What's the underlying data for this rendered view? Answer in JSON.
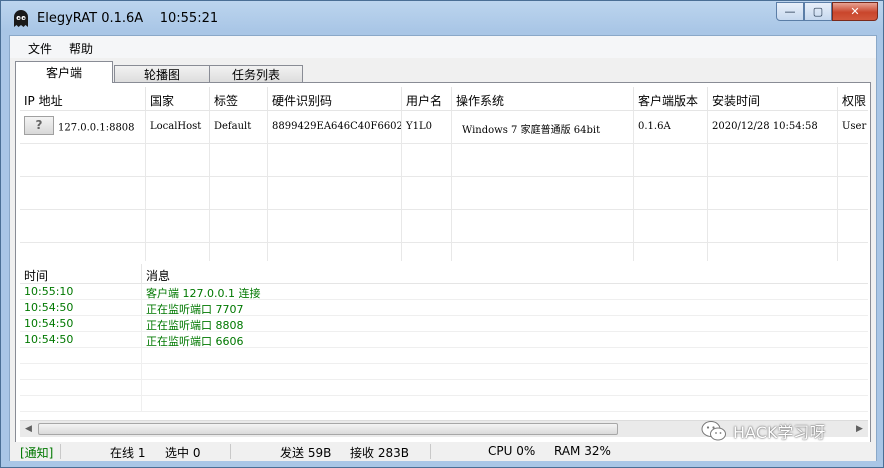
{
  "window": {
    "title": "ElegyRAT 0.1.6A",
    "time": "10:55:21",
    "controls": {
      "minimize": "—",
      "maximize": "▢",
      "close": "✕"
    }
  },
  "menu": [
    "文件",
    "帮助"
  ],
  "tabs": [
    "客户端",
    "轮播图",
    "任务列表"
  ],
  "clients": {
    "columns": [
      "IP 地址",
      "国家",
      "标签",
      "硬件识别码",
      "用户名",
      "操作系统",
      "客户端版本",
      "安装时间",
      "权限"
    ],
    "rows": [
      {
        "flag": "?",
        "ip": "127.0.0.1:8808",
        "country": "LocalHost",
        "tag": "Default",
        "hwid": "8899429EA646C40F6602",
        "user": "Y1L0",
        "os": "Windows 7 家庭普通版  64bit",
        "version": "0.1.6A",
        "install_time": "2020/12/28 10:54:58",
        "permission": "User"
      }
    ]
  },
  "log": {
    "columns": [
      "时间",
      "消息"
    ],
    "rows": [
      {
        "time": "10:55:10",
        "msg": "客户端 127.0.0.1 连接"
      },
      {
        "time": "10:54:50",
        "msg": "正在监听端口 7707"
      },
      {
        "time": "10:54:50",
        "msg": "正在监听端口 8808"
      },
      {
        "time": "10:54:50",
        "msg": "正在监听端口 6606"
      }
    ]
  },
  "status": {
    "notice": "[通知]",
    "online": "在线 1",
    "selected": "选中 0",
    "sent": "发送 59B",
    "received": "接收 283B",
    "cpu": "CPU 0%",
    "ram": "RAM 32%"
  },
  "watermark": "HACK学习呀",
  "colors": {
    "log_text": "#007800",
    "close_button": "#c9462c",
    "title_bar": "#a9c6e6"
  }
}
